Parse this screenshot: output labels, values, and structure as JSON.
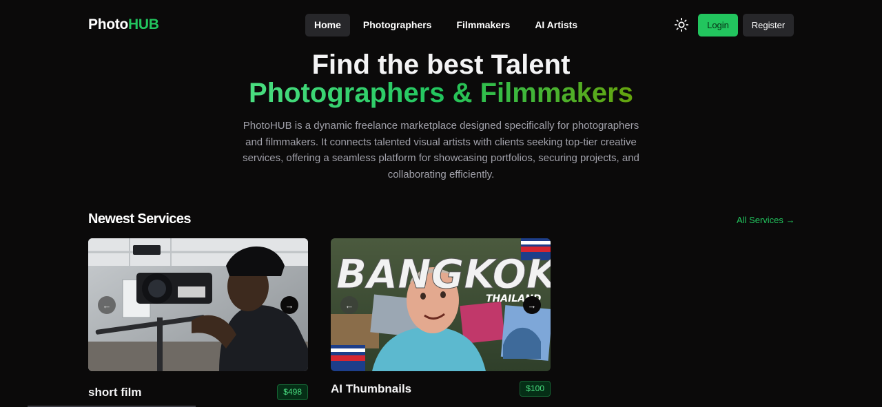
{
  "nav": {
    "logo_part1": "Photo",
    "logo_part2": "HUB",
    "links": [
      "Home",
      "Photographers",
      "Filmmakers",
      "AI Artists"
    ],
    "active": "Home",
    "theme_icon": "sun-icon",
    "login_label": "Login",
    "register_label": "Register"
  },
  "hero": {
    "title": "Find the best Talent",
    "subtitle": "Photographers & Filmmakers",
    "description": "PhotoHUB is a dynamic freelance marketplace designed specifically for photographers and filmmakers. It connects talented visual artists with clients seeking top-tier creative services, offering a seamless platform for showcasing portfolios, securing projects, and collaborating efficiently."
  },
  "services": {
    "title": "Newest Services",
    "all_link": "All Services →",
    "items": [
      {
        "name": "short film",
        "price": "$498",
        "image": "filmmaker-with-red-cinema-camera"
      },
      {
        "name": "AI Thumbnails",
        "price": "$100",
        "image": "bangkok-thailand-travel-thumbnail",
        "overlay_title": "BANGKOK",
        "overlay_sub": "THAILAND"
      }
    ]
  },
  "colors": {
    "accent": "#22c55e",
    "background": "#0b0a0a",
    "nav_active": "#27272a"
  }
}
